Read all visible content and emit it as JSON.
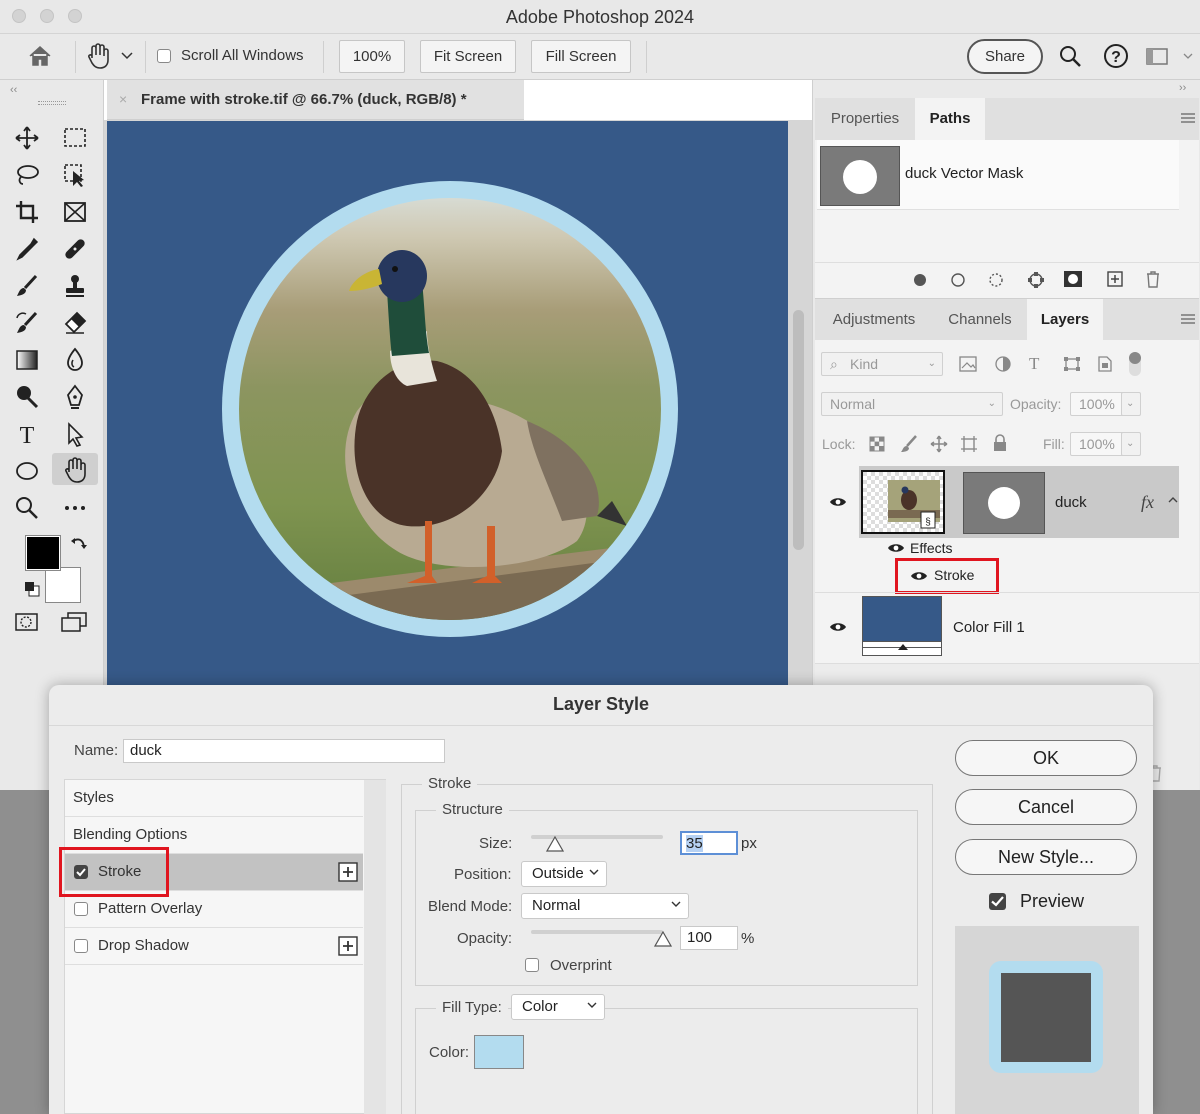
{
  "app": {
    "title": "Adobe Photoshop 2024"
  },
  "options_bar": {
    "scroll_all_windows": "Scroll All Windows",
    "zoom": "100%",
    "fit_screen": "Fit Screen",
    "fill_screen": "Fill Screen",
    "share": "Share"
  },
  "document": {
    "tab_title": "Frame with stroke.tif @ 66.7% (duck, RGB/8) *"
  },
  "colors": {
    "canvas_bg": "#365988",
    "stroke_color": "#b3dcef",
    "highlight": "#e0151f"
  },
  "paths_panel": {
    "tabs": [
      "Properties",
      "Paths"
    ],
    "active_tab": "Paths",
    "items": [
      {
        "label": "duck Vector Mask"
      }
    ]
  },
  "layers_panel": {
    "tabs": [
      "Adjustments",
      "Channels",
      "Layers"
    ],
    "active_tab": "Layers",
    "filter": "Kind",
    "blend_mode": "Normal",
    "opacity_label": "Opacity:",
    "opacity": "100%",
    "lock_label": "Lock:",
    "fill_label": "Fill:",
    "fill": "100%",
    "layers": [
      {
        "name": "duck",
        "fx": "fx",
        "effects_label": "Effects",
        "effect": "Stroke"
      },
      {
        "name": "Color Fill 1"
      }
    ]
  },
  "dialog": {
    "title": "Layer Style",
    "name_label": "Name:",
    "name_value": "duck",
    "styles": [
      {
        "label": "Styles"
      },
      {
        "label": "Blending Options"
      },
      {
        "label": "Stroke",
        "checked": true
      },
      {
        "label": "Pattern Overlay",
        "checked": false
      },
      {
        "label": "Drop Shadow",
        "checked": false
      }
    ],
    "section_title": "Stroke",
    "structure_title": "Structure",
    "size_label": "Size:",
    "size_value": "35",
    "size_unit": "px",
    "position_label": "Position:",
    "position_value": "Outside",
    "blend_mode_label": "Blend Mode:",
    "blend_mode_value": "Normal",
    "opacity_label": "Opacity:",
    "opacity_value": "100",
    "opacity_unit": "%",
    "overprint_label": "Overprint",
    "fill_type_label": "Fill Type:",
    "fill_type_value": "Color",
    "color_label": "Color:",
    "buttons": {
      "ok": "OK",
      "cancel": "Cancel",
      "new_style": "New Style..."
    },
    "preview_label": "Preview",
    "preview_checked": true
  }
}
